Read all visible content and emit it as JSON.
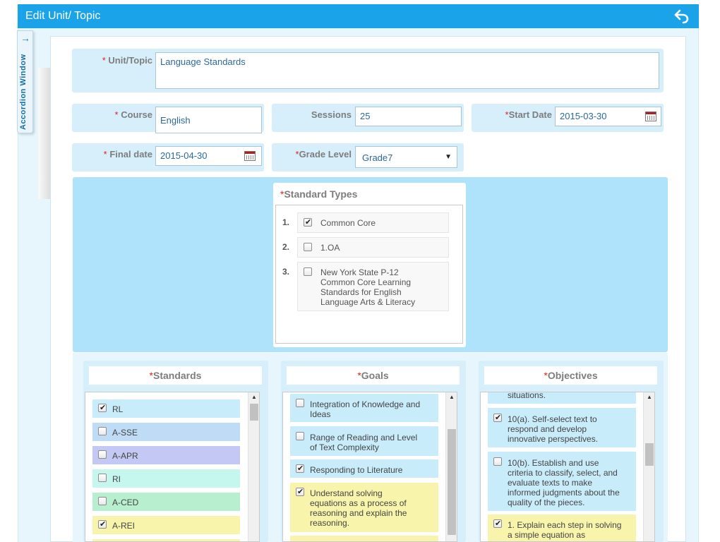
{
  "window": {
    "title": "Edit Unit/ Topic"
  },
  "accordion": {
    "label": "Accordion Window"
  },
  "form": {
    "unit_topic": {
      "label": "Unit/Topic",
      "value": "Language Standards"
    },
    "course": {
      "label": "Course",
      "value": "English"
    },
    "sessions": {
      "label": "Sessions",
      "value": "25"
    },
    "start_date": {
      "label": "Start Date",
      "value": "2015-03-30"
    },
    "final_date": {
      "label": "Final date",
      "value": "2015-04-30"
    },
    "grade_level": {
      "label": "Grade Level",
      "value": "Grade7"
    },
    "required_marker": "*"
  },
  "standard_types": {
    "header": "Standard Types",
    "items": [
      {
        "num": "1.",
        "label": "Common Core",
        "checked": true
      },
      {
        "num": "2.",
        "label": "1.OA",
        "checked": false
      },
      {
        "num": "3.",
        "label": "New York State P-12 Common Core Learning Standards for English Language Arts & Literacy",
        "checked": false
      }
    ]
  },
  "standards": {
    "header": "Standards",
    "items": [
      {
        "label": "RL",
        "checked": true,
        "color": "#c9ecfb"
      },
      {
        "label": "A-SSE",
        "checked": false,
        "color": "#bfdcf7"
      },
      {
        "label": "A-APR",
        "checked": false,
        "color": "#c3c9f4"
      },
      {
        "label": "RI",
        "checked": false,
        "color": "#c6f7ef"
      },
      {
        "label": "A-CED",
        "checked": false,
        "color": "#b8efce"
      },
      {
        "label": "A-REI",
        "checked": true,
        "color": "#f8f4ac"
      }
    ]
  },
  "goals": {
    "header": "Goals",
    "items": [
      {
        "label": "Integration of Knowledge and Ideas",
        "checked": false,
        "color": "#c9ecfb"
      },
      {
        "label": "Range of Reading and Level of Text Complexity",
        "checked": false,
        "color": "#c9ecfb"
      },
      {
        "label": "Responding to Literature",
        "checked": true,
        "color": "#c9ecfb"
      },
      {
        "label": "Understand solving equations as a process of reasoning and explain the reasoning.",
        "checked": true,
        "color": "#f8f4ac"
      }
    ]
  },
  "objectives": {
    "header": "Objectives",
    "items": [
      {
        "label": "situations.",
        "checked": false,
        "color": "#c9ecfb"
      },
      {
        "label": "10(a). Self-select text to respond and develop innovative perspectives.",
        "checked": true,
        "color": "#c9ecfb"
      },
      {
        "label": "10(b). Establish and use criteria to classify, select, and evaluate texts to make informed judgments about the quality of the pieces.",
        "checked": false,
        "color": "#c9ecfb"
      },
      {
        "label": "1. Explain each step in solving a simple equation as",
        "checked": true,
        "color": "#f8f4ac"
      }
    ]
  },
  "colors": {
    "titlebar": "#1aa3e8",
    "panel": "#aee3fb",
    "field_bg": "#d7effb",
    "required": "#e02020"
  }
}
